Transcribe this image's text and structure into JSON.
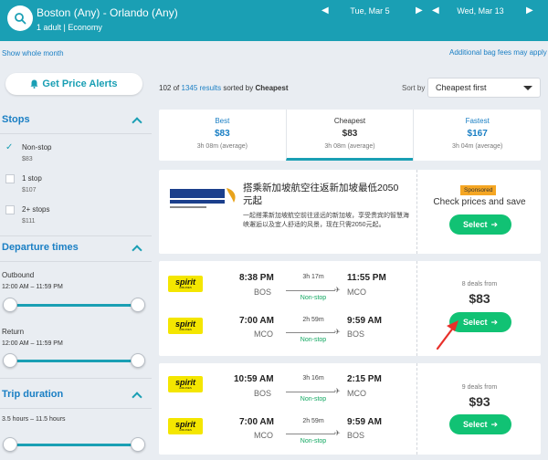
{
  "header": {
    "route": "Boston (Any) - Orlando (Any)",
    "passengers": "1 adult",
    "cabin": "Economy",
    "depart_date": "Tue, Mar 5",
    "return_date": "Wed, Mar 13"
  },
  "links": {
    "whole_month": "Show whole month",
    "bag_fees": "Additional bag fees may apply"
  },
  "price_alert": {
    "label": "Get Price Alerts"
  },
  "results": {
    "shown": "102",
    "of": "of",
    "total": "1345 results",
    "sorted_by": "sorted by",
    "sort_name": "Cheapest"
  },
  "sort": {
    "label": "Sort by",
    "value": "Cheapest first"
  },
  "filters": {
    "stops": {
      "title": "Stops",
      "options": [
        {
          "label": "Non-stop",
          "price": "$83",
          "checked": true
        },
        {
          "label": "1 stop",
          "price": "$107",
          "checked": false
        },
        {
          "label": "2+ stops",
          "price": "$111",
          "checked": false
        }
      ]
    },
    "departure_times": {
      "title": "Departure times",
      "outbound_label": "Outbound",
      "outbound_range": "12:00 AM – 11:59 PM",
      "return_label": "Return",
      "return_range": "12:00 AM – 11:59 PM"
    },
    "trip_duration": {
      "title": "Trip duration",
      "range": "3.5 hours – 11.5 hours"
    }
  },
  "summary": [
    {
      "label": "Best",
      "price": "$83",
      "duration": "3h 08m (average)"
    },
    {
      "label": "Cheapest",
      "price": "$83",
      "duration": "3h 08m (average)"
    },
    {
      "label": "Fastest",
      "price": "$167",
      "duration": "3h 04m (average)"
    }
  ],
  "ad": {
    "logo_text": "新加坡航空公司",
    "logo_sub": "SINGAPORE AIRLINES",
    "title": "搭乘新加坡航空往返新加坡最低2050元起",
    "description": "一起搭乘新加坡航空前往遥远的新加坡，享受贵宾的智慧海峡邂逅以及宜人舒适的风景，现在只需2050元起。",
    "sponsored": "Sponsored",
    "cta": "Check prices and save",
    "button": "Select"
  },
  "results_list": [
    {
      "deals": "8 deals from",
      "price": "$83",
      "button": "Select",
      "legs": [
        {
          "airline": "spirit",
          "dep_time": "8:38 PM",
          "dep_airport": "BOS",
          "duration": "3h 17m",
          "stops": "Non-stop",
          "arr_time": "11:55 PM",
          "arr_airport": "MCO"
        },
        {
          "airline": "spirit",
          "dep_time": "7:00 AM",
          "dep_airport": "MCO",
          "duration": "2h 59m",
          "stops": "Non-stop",
          "arr_time": "9:59 AM",
          "arr_airport": "BOS"
        }
      ]
    },
    {
      "deals": "9 deals from",
      "price": "$93",
      "button": "Select",
      "legs": [
        {
          "airline": "spirit",
          "dep_time": "10:59 AM",
          "dep_airport": "BOS",
          "duration": "3h 16m",
          "stops": "Non-stop",
          "arr_time": "2:15 PM",
          "arr_airport": "MCO"
        },
        {
          "airline": "spirit",
          "dep_time": "7:00 AM",
          "dep_airport": "MCO",
          "duration": "2h 59m",
          "stops": "Non-stop",
          "arr_time": "9:59 AM",
          "arr_airport": "BOS"
        }
      ]
    }
  ],
  "colors": {
    "header": "#1a9fb4",
    "accent_blue": "#1a7fc4",
    "select_green": "#11c274",
    "nonstop_green": "#11a760",
    "sponsored": "#f5a623",
    "spirit_yellow": "#f4e600",
    "annotation_red": "#e8302a"
  }
}
